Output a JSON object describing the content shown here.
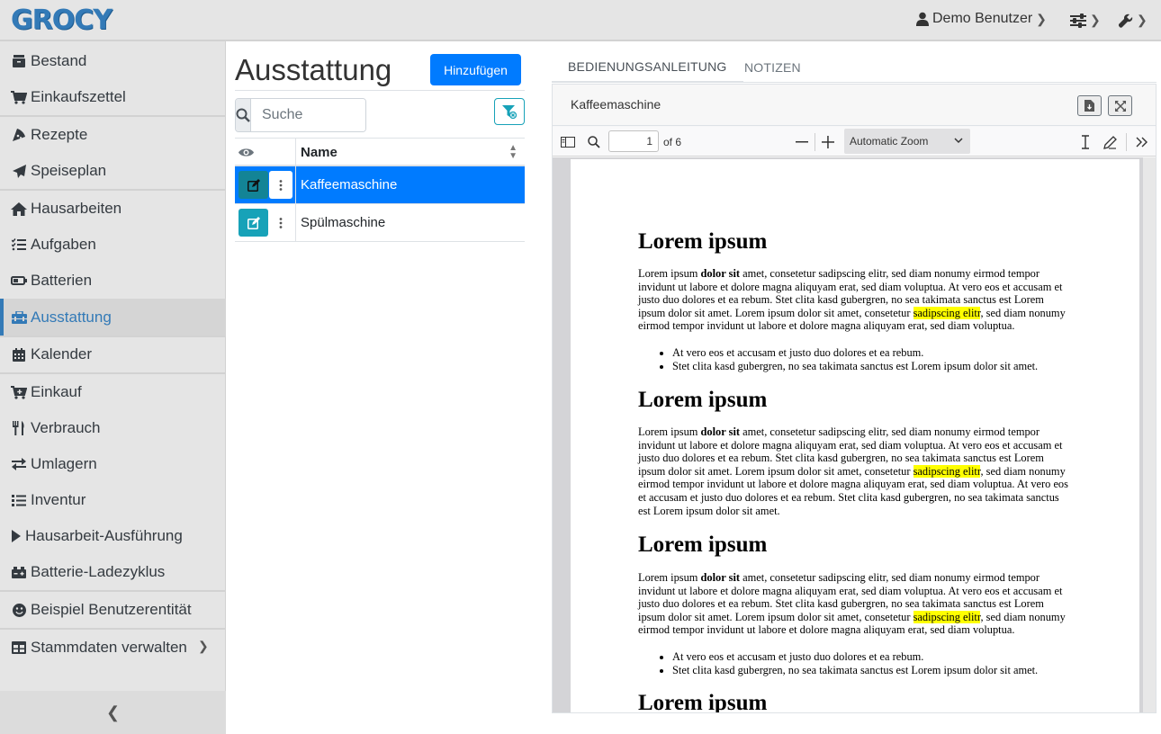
{
  "app": {
    "logo": "GROCY"
  },
  "topbar": {
    "user_name": "Demo Benutzer"
  },
  "sidebar": {
    "items": [
      {
        "label": "Bestand",
        "icon": "box-icon"
      },
      {
        "label": "Einkaufszettel",
        "icon": "shopping-cart-icon"
      },
      {
        "label": "Rezepte",
        "icon": "pizza-icon"
      },
      {
        "label": "Speiseplan",
        "icon": "paper-plane-icon"
      },
      {
        "label": "Hausarbeiten",
        "icon": "home-icon"
      },
      {
        "label": "Aufgaben",
        "icon": "tasks-icon"
      },
      {
        "label": "Batterien",
        "icon": "battery-icon"
      },
      {
        "label": "Ausstattung",
        "icon": "toolbox-icon"
      },
      {
        "label": "Kalender",
        "icon": "calendar-icon"
      },
      {
        "label": "Einkauf",
        "icon": "cart-plus-icon"
      },
      {
        "label": "Verbrauch",
        "icon": "utensils-icon"
      },
      {
        "label": "Umlagern",
        "icon": "exchange-icon"
      },
      {
        "label": "Inventur",
        "icon": "list-icon"
      },
      {
        "label": "Hausarbeit-Ausführung",
        "icon": "play-icon"
      },
      {
        "label": "Batterie-Ladezyklus",
        "icon": "car-battery-icon"
      },
      {
        "label": "Beispiel Benutzerentität",
        "icon": "smile-icon"
      },
      {
        "label": "Stammdaten verwalten",
        "icon": "table-icon"
      }
    ],
    "active": "Ausstattung"
  },
  "equipment": {
    "title": "Ausstattung",
    "add_label": "Hinzufügen",
    "search_placeholder": "Suche",
    "table": {
      "column_name": "Name",
      "rows": [
        {
          "name": "Kaffeemaschine",
          "selected": true
        },
        {
          "name": "Spülmaschine",
          "selected": false
        }
      ]
    }
  },
  "detail": {
    "tabs": [
      "BEDIENUNGSANLEITUNG",
      "NOTIZEN"
    ],
    "active_tab": "BEDIENUNGSANLEITUNG",
    "card_title": "Kaffeemaschine"
  },
  "pdf": {
    "page": "1",
    "page_count": "of 6",
    "zoom": "Automatic Zoom",
    "heading": "Lorem ipsum",
    "p_start": "Lorem ipsum ",
    "p_bold": "dolor sit",
    "p_mid": " amet, consetetur sadipscing elitr, sed diam nonumy eirmod tempor invidunt ut labore et dolore magna aliquyam erat, sed diam voluptua. At vero eos et accusam et justo duo dolores et ea rebum. Stet clita kasd gubergren, no sea takimata sanctus est Lorem ipsum dolor sit amet. Lorem ipsum dolor sit amet, consetetur ",
    "p_highlight": "sadipscing elitr",
    "p_end": ", sed diam nonumy eirmod tempor invidunt ut labore et dolore magna aliquyam erat, sed diam voluptua.",
    "p_extra": " At vero eos et accusam et justo duo dolores et ea rebum. Stet clita kasd gubergren, no sea takimata sanctus est Lorem ipsum dolor sit amet.",
    "bullet_1": "At vero eos et accusam et justo duo dolores et ea rebum.",
    "bullet_2": "Stet clita kasd gubergren, no sea takimata sanctus est Lorem ipsum dolor sit amet."
  },
  "colors": {
    "primary": "#007bff",
    "info": "#17a2b8",
    "highlight": "#ffff00",
    "brand": "#337ab7"
  }
}
